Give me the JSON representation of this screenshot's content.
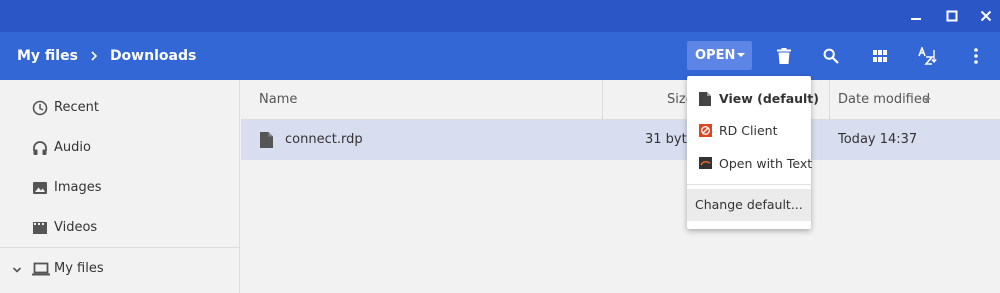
{
  "breadcrumb": {
    "root": "My files",
    "current": "Downloads"
  },
  "toolbar": {
    "open_label": "OPEN"
  },
  "sidebar": {
    "items": [
      {
        "label": "Recent",
        "icon": "clock-icon"
      },
      {
        "label": "Audio",
        "icon": "headphones-icon"
      },
      {
        "label": "Images",
        "icon": "image-icon"
      },
      {
        "label": "Videos",
        "icon": "film-icon"
      }
    ],
    "my_files": {
      "label": "My files",
      "icon": "laptop-icon"
    }
  },
  "list": {
    "headers": {
      "name": "Name",
      "size": "Size",
      "date": "Date modified"
    },
    "rows": [
      {
        "name": "connect.rdp",
        "size": "31 bytes",
        "date": "Today 14:37"
      }
    ]
  },
  "open_menu": {
    "items": [
      {
        "label": "View (default)",
        "icon": "document-icon"
      },
      {
        "label": "RD Client",
        "icon": "rd-client-icon"
      },
      {
        "label": "Open with Text",
        "icon": "text-editor-icon"
      }
    ],
    "change_default": "Change default..."
  },
  "colors": {
    "titlebar": "#2a56c6",
    "header": "#3367d6",
    "open_button": "#5c85e5",
    "selected_row": "#d8def0",
    "background": "#f2f2f2"
  }
}
